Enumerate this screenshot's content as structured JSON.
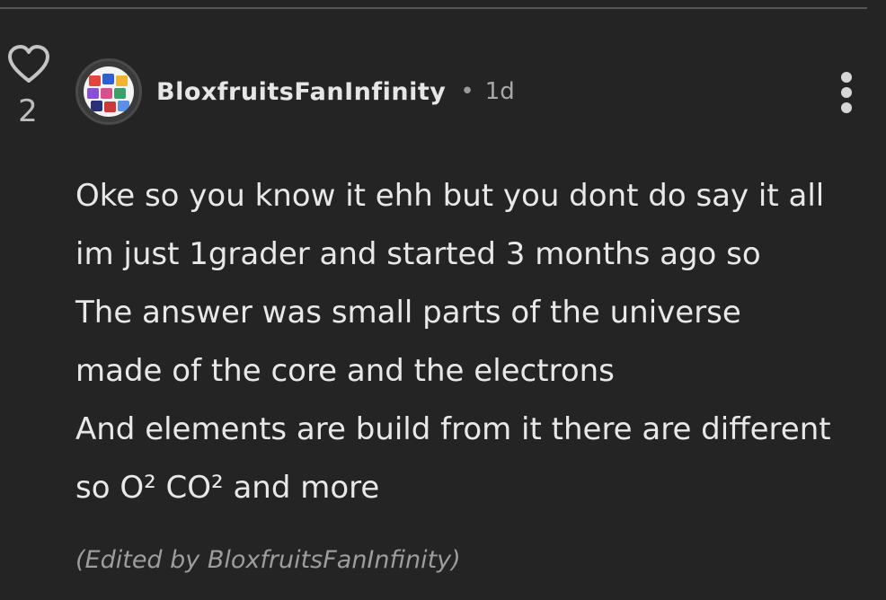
{
  "comment": {
    "likes": "2",
    "author": "BloxfruitsFanInfinity",
    "separator": "•",
    "time_ago": "1d",
    "body_lines": [
      "Oke so you know it ehh but you dont do say it all",
      "im just 1grader and started 3 months ago so",
      "The answer was small parts of the universe",
      "made of the core and the electrons",
      "And elements are build from it there are different",
      "so O² CO² and more"
    ],
    "edited_note": "(Edited by BloxfruitsFanInfinity)"
  },
  "icons": {
    "like": "heart-outline-icon",
    "more": "more-vertical-icon"
  },
  "colors": {
    "background": "#242424",
    "text": "#e8e8e8",
    "muted": "#9d9d9d"
  }
}
